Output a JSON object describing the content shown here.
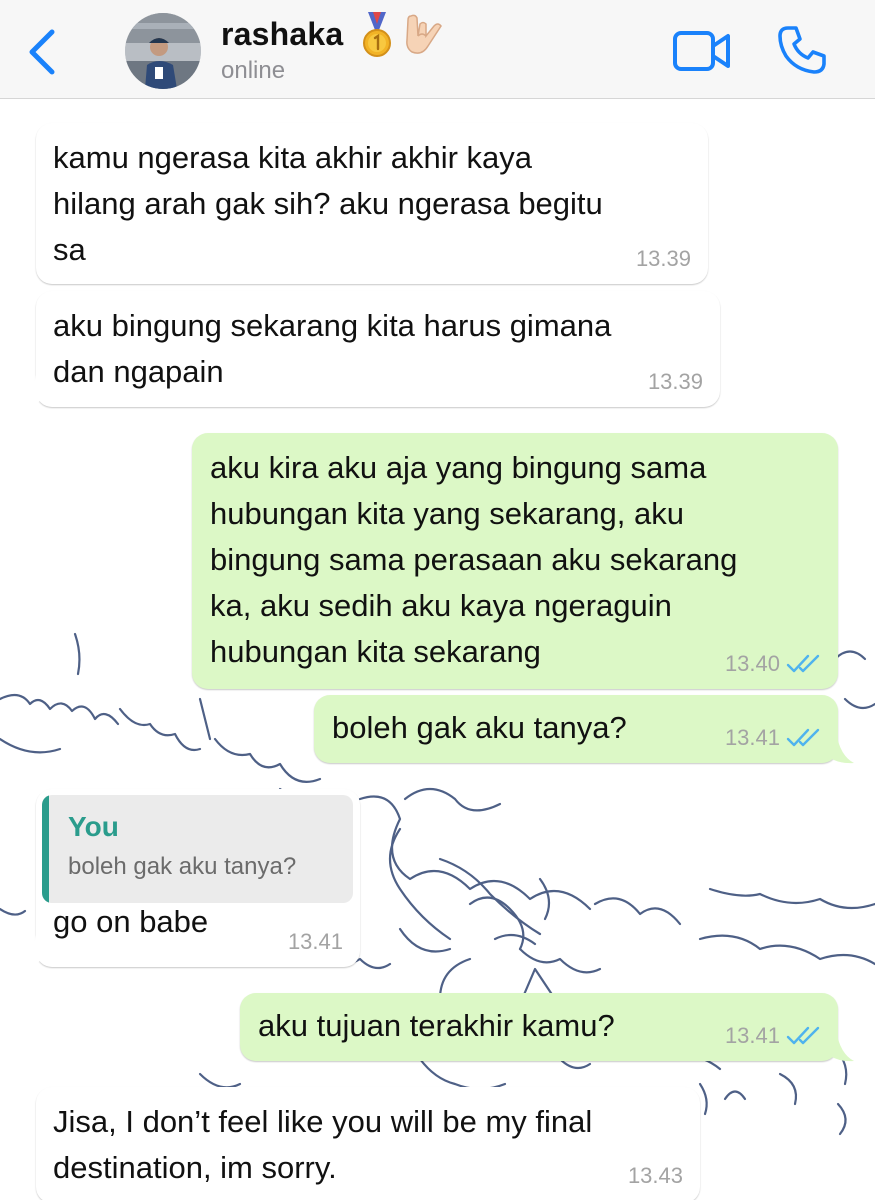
{
  "header": {
    "contact_name": "rashaka",
    "name_emojis": [
      "medal-emoji",
      "love-you-gesture-emoji"
    ],
    "status": "online",
    "icons": [
      "back-chevron-icon",
      "video-call-icon",
      "phone-icon"
    ]
  },
  "messages": [
    {
      "direction": "incoming",
      "text": "kamu ngerasa kita akhir akhir kaya\nhilang arah gak sih? aku ngerasa begitu\nsa",
      "time": "13.39"
    },
    {
      "direction": "incoming",
      "text": "aku bingung sekarang kita harus gimana\ndan ngapain",
      "time": "13.39"
    },
    {
      "direction": "outgoing",
      "text": "aku kira aku aja yang bingung sama\nhubungan kita yang sekarang, aku\nbingung sama perasaan aku sekarang\nka, aku sedih aku kaya ngeraguin\nhubungan kita sekarang",
      "time": "13.40",
      "status": "read"
    },
    {
      "direction": "outgoing",
      "text": "boleh gak aku tanya?",
      "time": "13.41",
      "status": "read"
    },
    {
      "direction": "incoming",
      "reply_to": {
        "author": "You",
        "text": "boleh gak aku tanya?"
      },
      "text": "go on babe",
      "time": "13.41"
    },
    {
      "direction": "outgoing",
      "text": "aku tujuan terakhir kamu?",
      "time": "13.41",
      "status": "read"
    },
    {
      "direction": "incoming",
      "text": "Jisa, I don’t feel like you will be my final\ndestination, im sorry.",
      "time": "13.43"
    }
  ],
  "colors": {
    "accent_blue": "#1a82fb",
    "outgoing_bubble": "#dcf8c6",
    "incoming_bubble": "#ffffff",
    "reply_accent": "#2a9c8c",
    "read_ticks": "#4fb3ee",
    "wallpaper_doodle": "#3b4f7a"
  }
}
